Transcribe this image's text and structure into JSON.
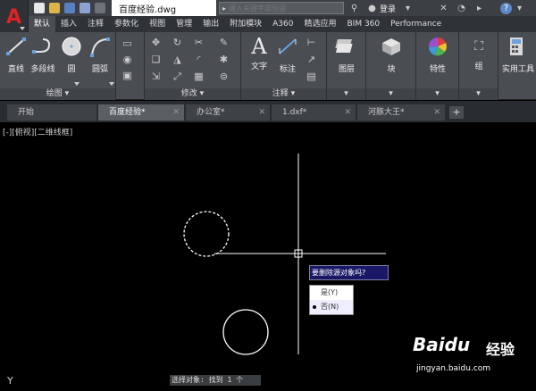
{
  "titlebar": {
    "document_title": "百度经验.dwg",
    "search_placeholder": "键入关键字或短语",
    "login_label": "登录"
  },
  "ribbon_tabs": [
    {
      "label": "默认",
      "active": true
    },
    {
      "label": "插入"
    },
    {
      "label": "注释"
    },
    {
      "label": "参数化"
    },
    {
      "label": "视图"
    },
    {
      "label": "管理"
    },
    {
      "label": "输出"
    },
    {
      "label": "附加模块"
    },
    {
      "label": "A360"
    },
    {
      "label": "精选应用"
    },
    {
      "label": "BIM 360"
    },
    {
      "label": "Performance"
    }
  ],
  "ribbon": {
    "draw_tools": {
      "line": "直线",
      "polyline": "多段线",
      "circle": "圆",
      "arc": "圆弧"
    },
    "annotation_tools": {
      "text": "文字",
      "dimension": "标注"
    },
    "layer_label": "图层",
    "block_label": "块",
    "properties_label": "特性",
    "group_label": "组",
    "utilities_label": "实用工具",
    "footers": {
      "draw": "绘图",
      "modify": "修改",
      "annotation": "注释"
    }
  },
  "file_tabs": [
    {
      "label": "开始"
    },
    {
      "label": "百度经验*",
      "active": true
    },
    {
      "label": "办公室*"
    },
    {
      "label": "1.dxf*"
    },
    {
      "label": "河豚大王*"
    }
  ],
  "add_tab_label": "+",
  "canvas": {
    "viewport_label": "[-][俯视][二维线框]",
    "prompt": "要删除源对象吗?",
    "options": [
      {
        "label": "是(Y)",
        "selected": false
      },
      {
        "label": "否(N)",
        "selected": true
      }
    ],
    "command_line": "选择对象: 找到 1 个",
    "ucs_label": "Y"
  },
  "watermark": {
    "brand": "Baidu",
    "brand_cn": "经验",
    "url": "jingyan.baidu.com"
  },
  "colors": {
    "app_logo": "#dd2222",
    "ribbon_bg": "#4a4e53",
    "canvas_bg": "#000000",
    "prompt_bg": "#1a1866"
  }
}
